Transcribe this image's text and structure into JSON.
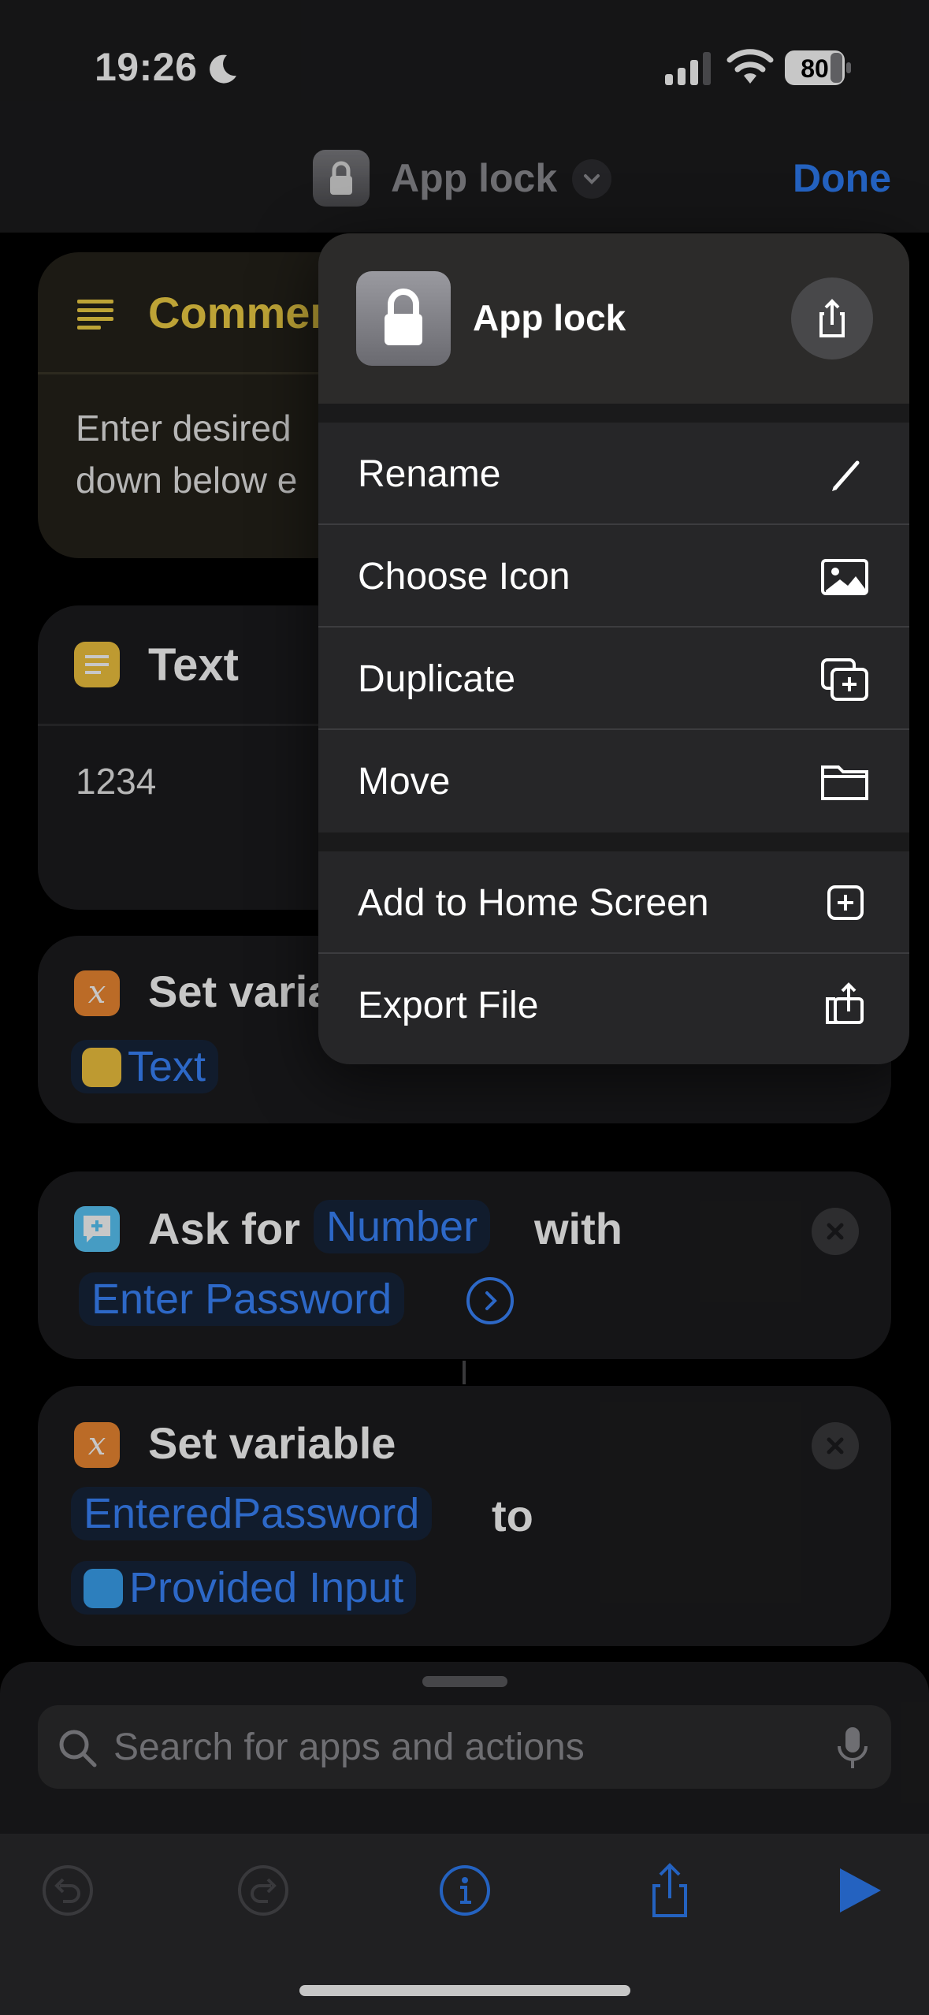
{
  "status_bar": {
    "time": "19:26",
    "battery": "80"
  },
  "nav": {
    "title": "App lock",
    "done_label": "Done"
  },
  "comment_card": {
    "title": "Commen",
    "body": "Enter desired\ndown below e"
  },
  "text_card": {
    "title": "Text",
    "value": "1234"
  },
  "set_variable_1": {
    "title": "Set varia",
    "token": "Text"
  },
  "ask_card": {
    "ask_for": "Ask for",
    "type_token": "Number",
    "with": "with",
    "prompt_token": "Enter Password"
  },
  "set_variable_2": {
    "title": "Set variable",
    "variable_token": "EnteredPassword",
    "to": "to",
    "input_token": "Provided Input"
  },
  "search": {
    "placeholder": "Search for apps and actions"
  },
  "menu": {
    "title": "App lock",
    "items": [
      {
        "label": "Rename",
        "icon": "pencil-icon"
      },
      {
        "label": "Choose Icon",
        "icon": "photo-icon"
      },
      {
        "label": "Duplicate",
        "icon": "duplicate-icon"
      },
      {
        "label": "Move",
        "icon": "folder-icon"
      },
      {
        "label": "Add to Home Screen",
        "icon": "plus-square-icon"
      },
      {
        "label": "Export File",
        "icon": "export-icon"
      }
    ]
  },
  "colors": {
    "accent": "#2f7ef6",
    "comment": "#f2d146",
    "token_bg": "#16243a"
  }
}
